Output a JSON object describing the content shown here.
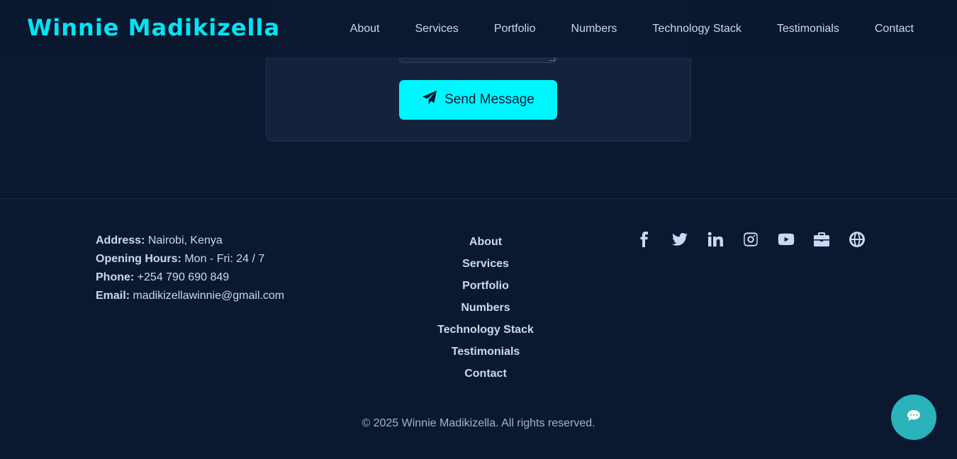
{
  "header": {
    "logo": "Winnie Madikizella",
    "nav": [
      "About",
      "Services",
      "Portfolio",
      "Numbers",
      "Technology Stack",
      "Testimonials",
      "Contact"
    ]
  },
  "contact_form": {
    "send_label": "Send Message"
  },
  "footer": {
    "info": [
      {
        "label": "Address:",
        "value": "Nairobi, Kenya"
      },
      {
        "label": "Opening Hours:",
        "value": "Mon - Fri: 24 / 7"
      },
      {
        "label": "Phone:",
        "value": "+254 790 690 849"
      },
      {
        "label": "Email:",
        "value": "madikizellawinnie@gmail.com"
      }
    ],
    "links": [
      "About",
      "Services",
      "Portfolio",
      "Numbers",
      "Technology Stack",
      "Testimonials",
      "Contact"
    ],
    "socials": [
      "facebook-icon",
      "twitter-icon",
      "linkedin-icon",
      "instagram-icon",
      "youtube-icon",
      "briefcase-icon",
      "globe-icon"
    ],
    "copyright": "© 2025 Winnie Madikizella. All rights reserved."
  },
  "colors": {
    "background": "#0a192f",
    "accent": "#00f6ff",
    "chat": "#2ab3bb"
  }
}
